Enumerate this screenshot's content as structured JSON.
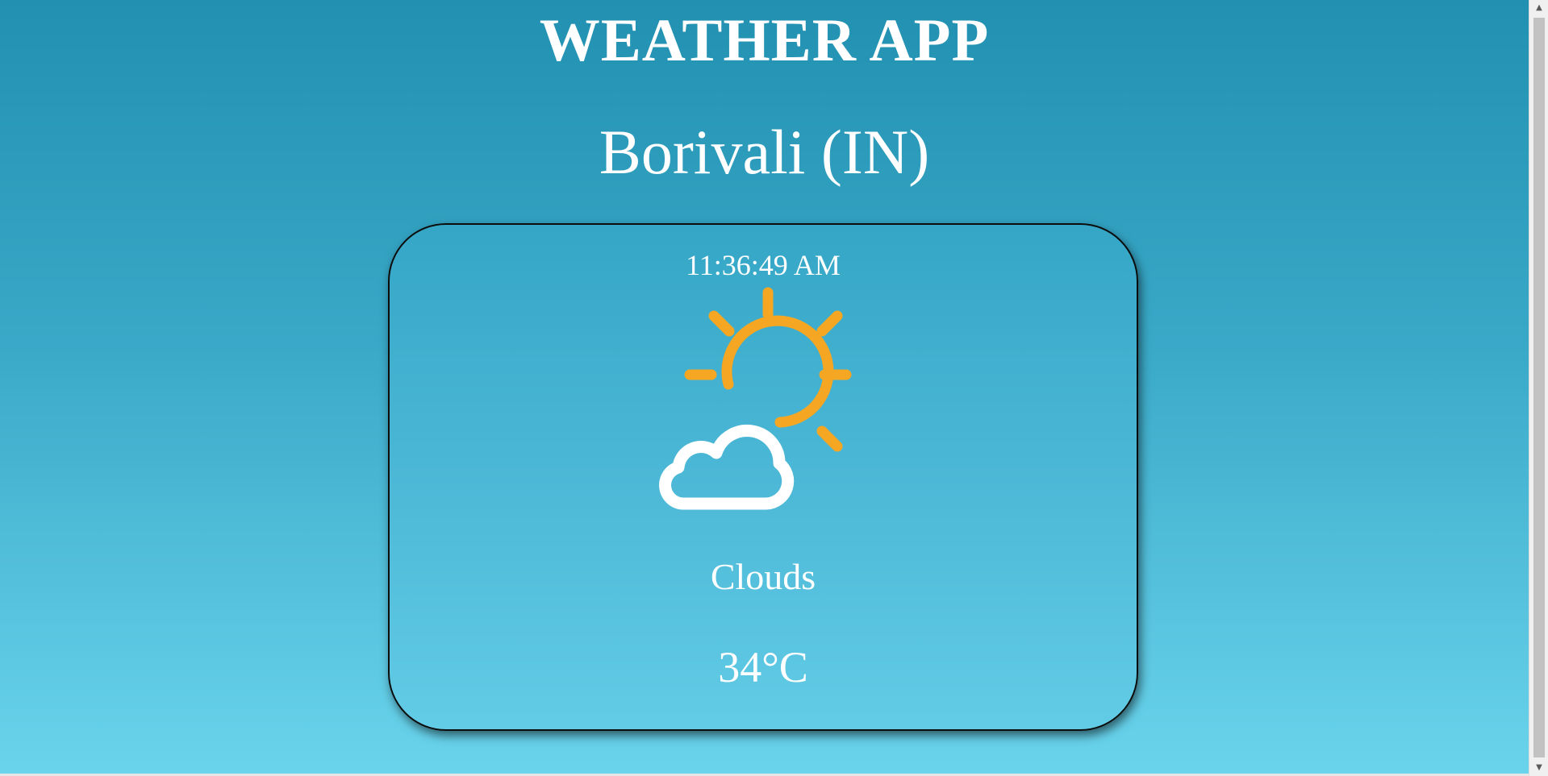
{
  "app": {
    "title": "WEATHER APP"
  },
  "location": {
    "display": "Borivali (IN)"
  },
  "card": {
    "time": "11:36:49 AM",
    "condition": "Clouds",
    "temperature": "34°C",
    "icon": "partly-cloudy-icon"
  },
  "colors": {
    "background_top": "#2291b1",
    "background_bottom": "#6ad4ec",
    "sun": "#f5a623",
    "cloud": "#ffffff",
    "card_border": "#0c0c0c"
  },
  "scrollbar": {
    "up_icon": "chevron-up-icon",
    "down_icon": "chevron-down-icon"
  }
}
